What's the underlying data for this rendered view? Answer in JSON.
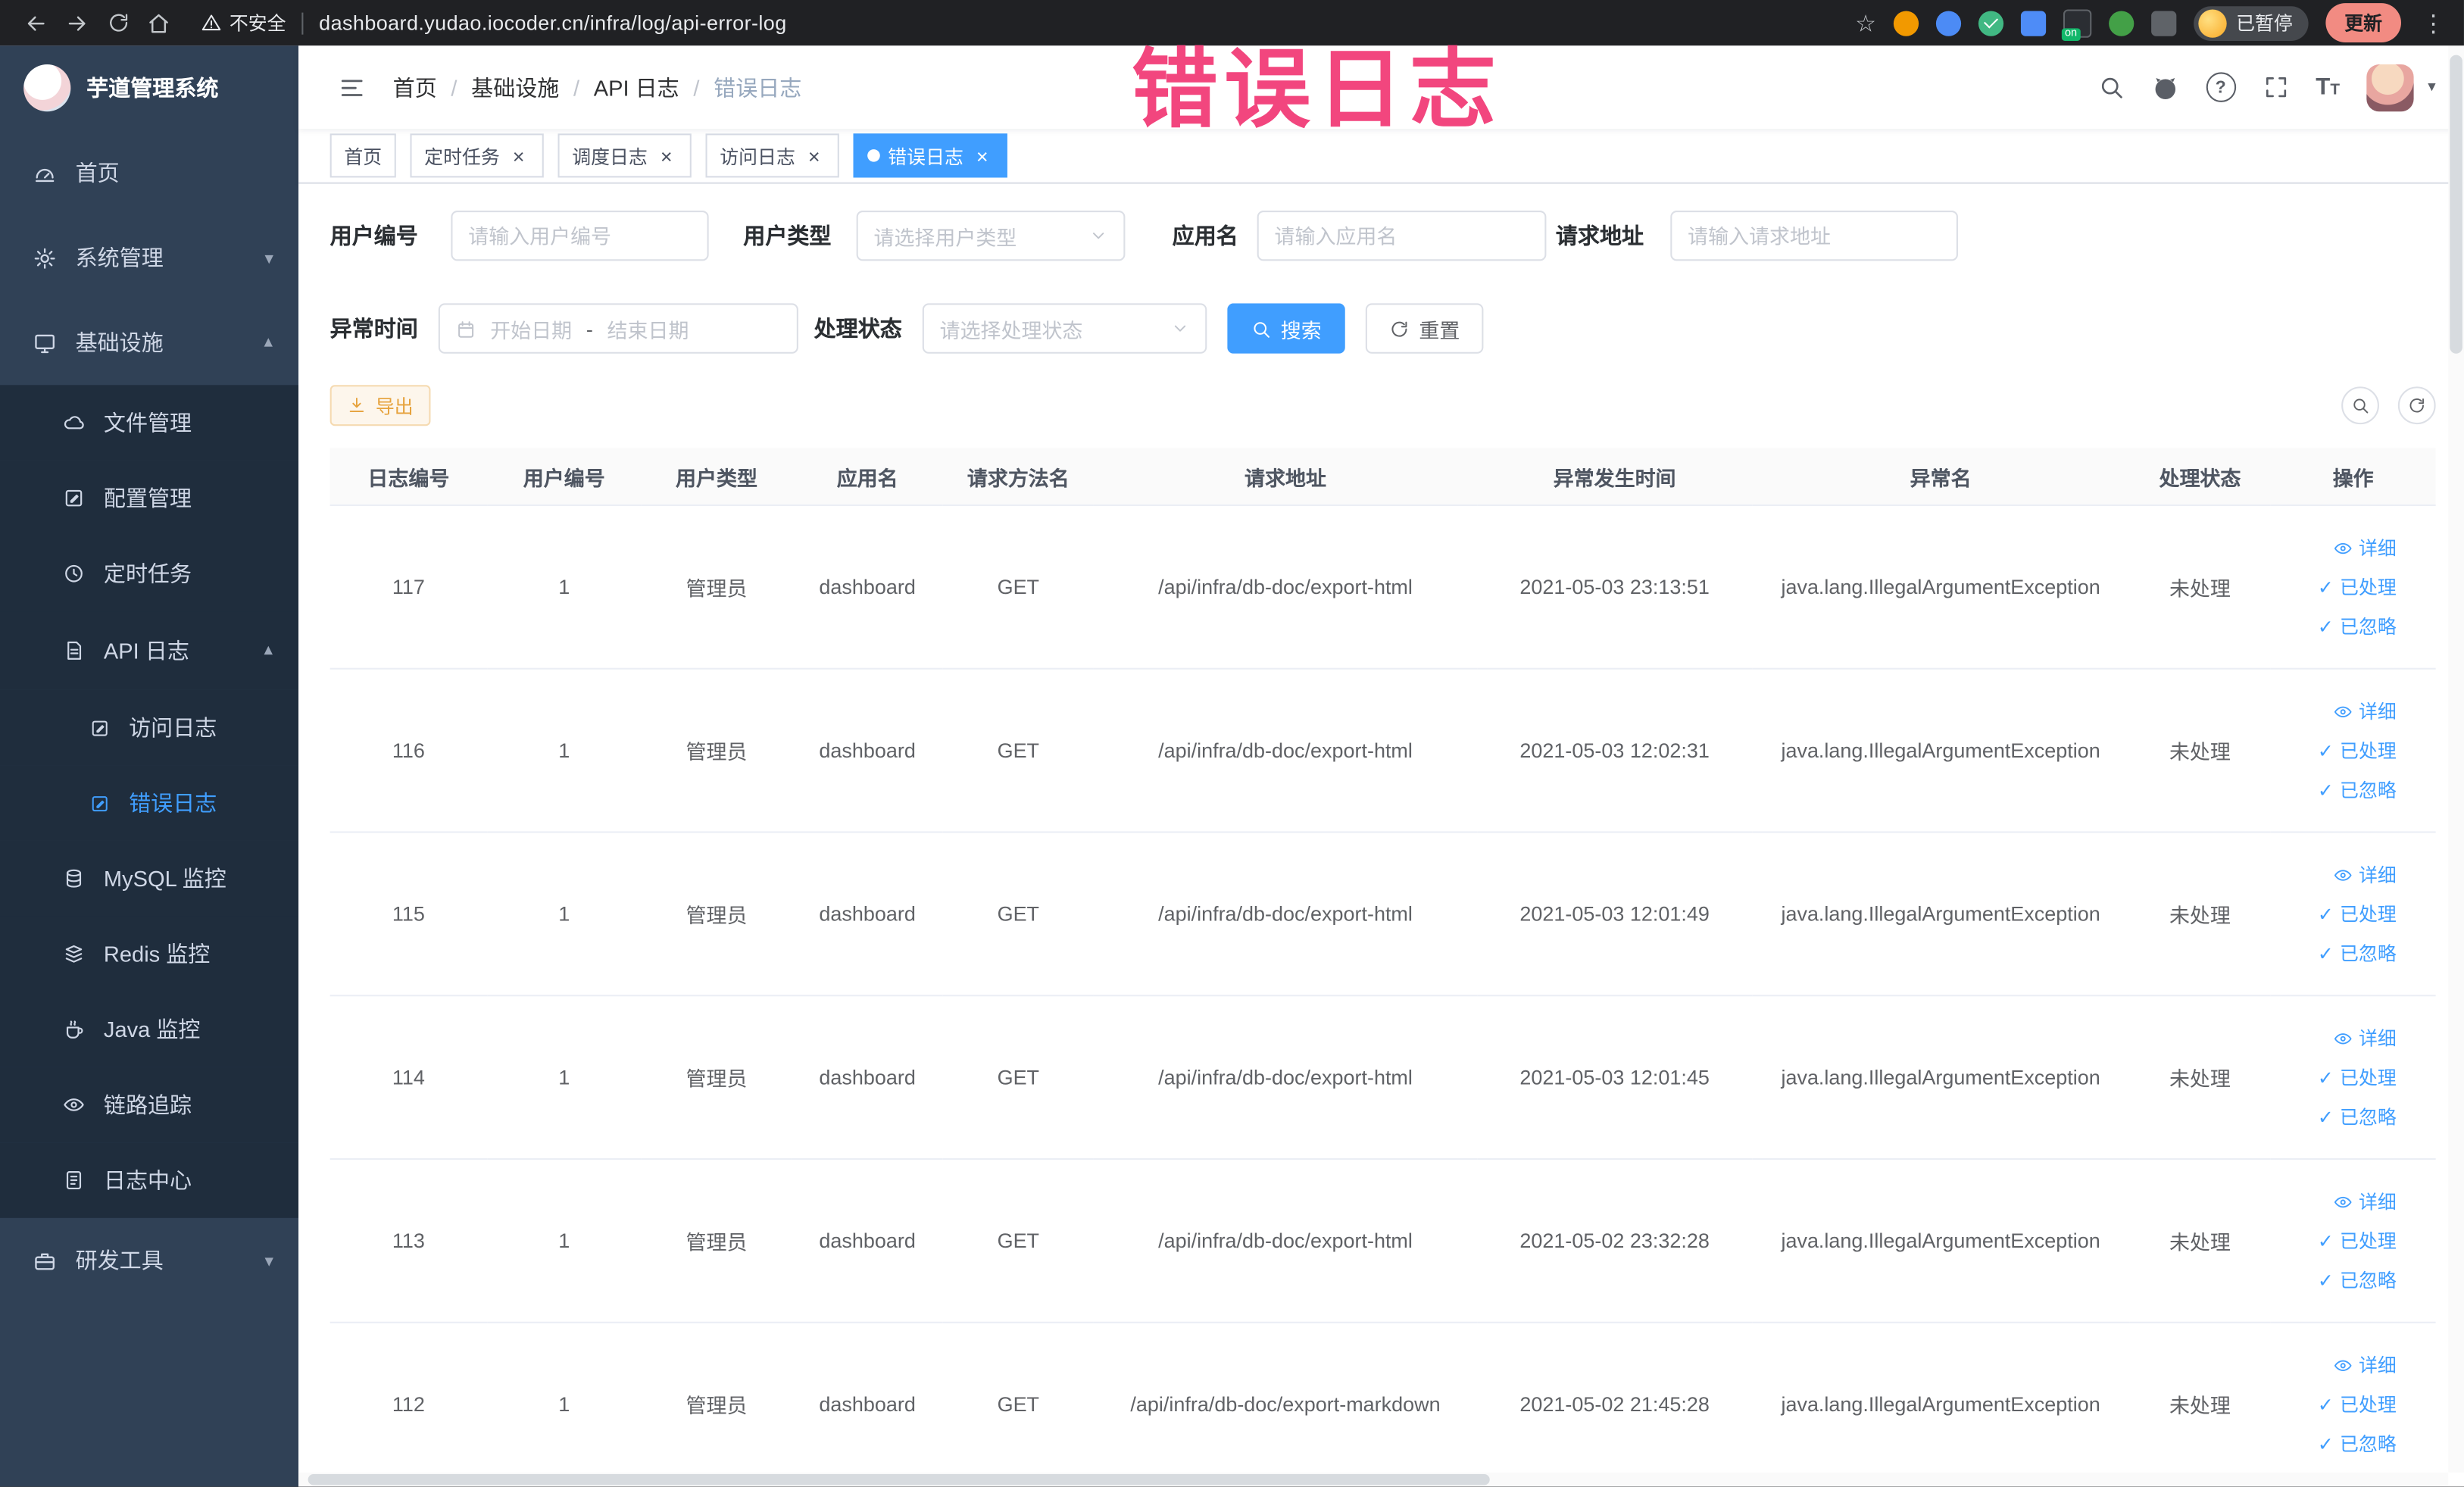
{
  "browser": {
    "security_label": "不安全",
    "url": "dashboard.yudao.iocoder.cn/infra/log/api-error-log",
    "paused_label": "已暂停",
    "update_label": "更新",
    "extension_badge": "on"
  },
  "annotation": {
    "text": "错误日志",
    "color": "#f2467e"
  },
  "sidebar": {
    "logo_title": "芋道管理系统",
    "items": [
      {
        "label": "首页"
      },
      {
        "label": "系统管理"
      },
      {
        "label": "基础设施"
      },
      {
        "label": "文件管理"
      },
      {
        "label": "配置管理"
      },
      {
        "label": "定时任务"
      },
      {
        "label": "API 日志"
      },
      {
        "label": "访问日志"
      },
      {
        "label": "错误日志"
      },
      {
        "label": "MySQL 监控"
      },
      {
        "label": "Redis 监控"
      },
      {
        "label": "Java 监控"
      },
      {
        "label": "链路追踪"
      },
      {
        "label": "日志中心"
      },
      {
        "label": "研发工具"
      }
    ]
  },
  "breadcrumb": {
    "items": [
      "首页",
      "基础设施",
      "API 日志",
      "错误日志"
    ],
    "separator": "/"
  },
  "tabs": [
    {
      "label": "首页"
    },
    {
      "label": "定时任务"
    },
    {
      "label": "调度日志"
    },
    {
      "label": "访问日志"
    },
    {
      "label": "错误日志"
    }
  ],
  "filters": {
    "user_id": {
      "label": "用户编号",
      "placeholder": "请输入用户编号"
    },
    "user_type": {
      "label": "用户类型",
      "placeholder": "请选择用户类型"
    },
    "app_name": {
      "label": "应用名",
      "placeholder": "请输入应用名"
    },
    "request_url": {
      "label": "请求地址",
      "placeholder": "请输入请求地址"
    },
    "exception_time": {
      "label": "异常时间",
      "start_placeholder": "开始日期",
      "separator": "-",
      "end_placeholder": "结束日期"
    },
    "process_status": {
      "label": "处理状态",
      "placeholder": "请选择处理状态"
    },
    "search_label": "搜索",
    "reset_label": "重置"
  },
  "toolbar": {
    "export_label": "导出"
  },
  "table": {
    "columns": [
      "日志编号",
      "用户编号",
      "用户类型",
      "应用名",
      "请求方法名",
      "请求地址",
      "异常发生时间",
      "异常名",
      "处理状态",
      "操作"
    ],
    "actions": {
      "detail": "详细",
      "process": "已处理",
      "ignore": "已忽略"
    },
    "rows": [
      {
        "id": "117",
        "user_id": "1",
        "user_type": "管理员",
        "app": "dashboard",
        "method": "GET",
        "url": "/api/infra/db-doc/export-html",
        "time": "2021-05-03 23:13:51",
        "exception": "java.lang.IllegalArgumentException",
        "status": "未处理"
      },
      {
        "id": "116",
        "user_id": "1",
        "user_type": "管理员",
        "app": "dashboard",
        "method": "GET",
        "url": "/api/infra/db-doc/export-html",
        "time": "2021-05-03 12:02:31",
        "exception": "java.lang.IllegalArgumentException",
        "status": "未处理"
      },
      {
        "id": "115",
        "user_id": "1",
        "user_type": "管理员",
        "app": "dashboard",
        "method": "GET",
        "url": "/api/infra/db-doc/export-html",
        "time": "2021-05-03 12:01:49",
        "exception": "java.lang.IllegalArgumentException",
        "status": "未处理"
      },
      {
        "id": "114",
        "user_id": "1",
        "user_type": "管理员",
        "app": "dashboard",
        "method": "GET",
        "url": "/api/infra/db-doc/export-html",
        "time": "2021-05-03 12:01:45",
        "exception": "java.lang.IllegalArgumentException",
        "status": "未处理"
      },
      {
        "id": "113",
        "user_id": "1",
        "user_type": "管理员",
        "app": "dashboard",
        "method": "GET",
        "url": "/api/infra/db-doc/export-html",
        "time": "2021-05-02 23:32:28",
        "exception": "java.lang.IllegalArgumentException",
        "status": "未处理"
      },
      {
        "id": "112",
        "user_id": "1",
        "user_type": "管理员",
        "app": "dashboard",
        "method": "GET",
        "url": "/api/infra/db-doc/export-markdown",
        "time": "2021-05-02 21:45:28",
        "exception": "java.lang.IllegalArgumentException",
        "status": "未处理"
      }
    ]
  },
  "icons": {
    "star": "☆",
    "menu_dots": "⋮",
    "check": "✓",
    "close": "×",
    "question": "?",
    "font_size": "T",
    "caret": "▾"
  },
  "colors": {
    "accent": "#409EFF",
    "warning": "#E6A23C",
    "sidebar_bg": "#304156",
    "submenu_bg": "#1f2d3d"
  }
}
